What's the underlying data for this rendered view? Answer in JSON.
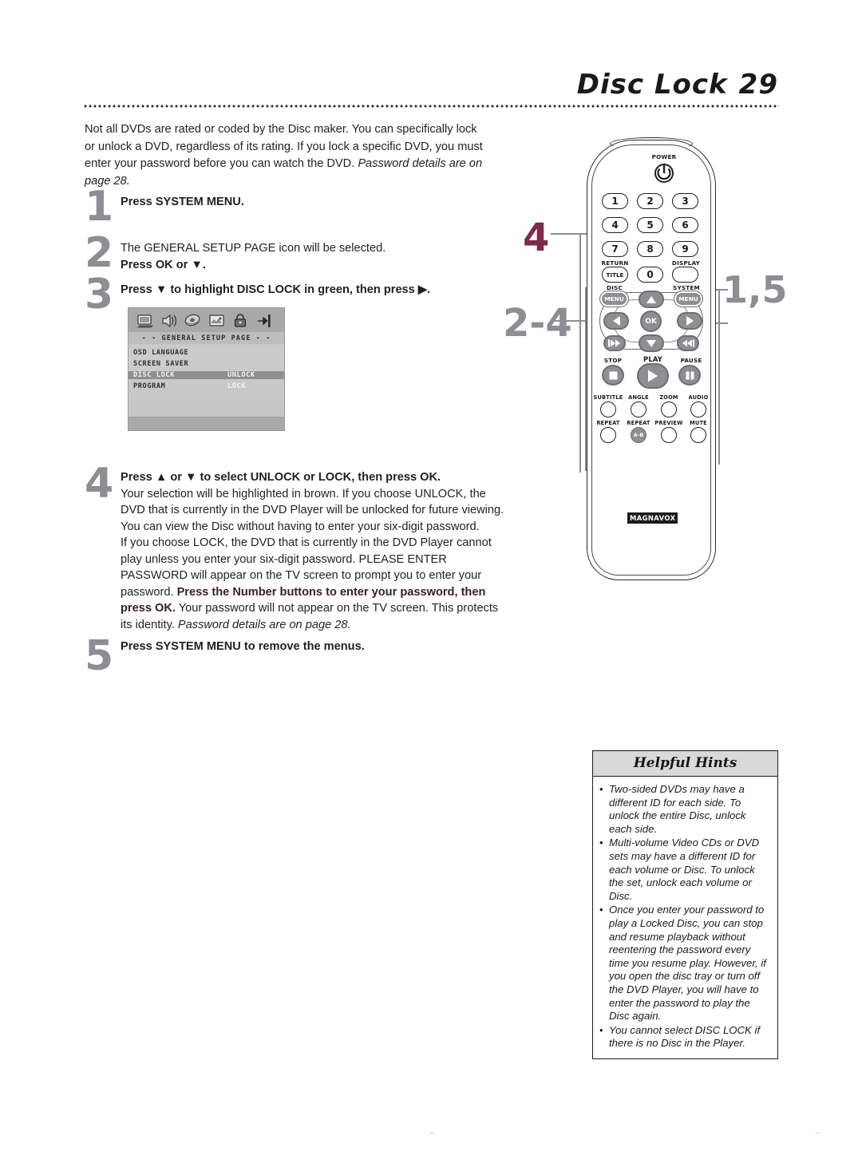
{
  "header": {
    "title": "Disc Lock",
    "page_number": "29"
  },
  "intro": {
    "text_plain": "Not all DVDs are rated or coded by the Disc maker. You can specifically lock or unlock a DVD, regardless of its rating. If you lock a specific DVD, you must enter your password before you can watch the DVD. ",
    "text_italic": "Password details are on page 28."
  },
  "steps": [
    {
      "number": "1",
      "bold_lead": "Press SYSTEM MENU.",
      "rest": ""
    },
    {
      "number": "2",
      "plain_lead": "The GENERAL SETUP PAGE icon will be selected.",
      "bold_lead": "Press OK or ▼."
    },
    {
      "number": "3",
      "bold_lead": "Press ▼  to highlight DISC LOCK in green, then press ▶."
    },
    {
      "number": "4",
      "bold_lead": "Press ▲ or ▼ to select UNLOCK or LOCK, then press OK.",
      "para1": "Your selection will be highlighted in brown. If you choose UNLOCK, the DVD that is currently in the DVD Player will be unlocked for future viewing. You can view the Disc without having to enter your six-digit password.",
      "para2_a": "If you choose LOCK, the DVD that is currently in the DVD Player cannot play unless you enter your six-digit password. PLEASE ENTER PASSWORD will appear on the TV screen to prompt you to enter your password. ",
      "para2_bold": "Press the Number buttons to enter your password, then press OK.",
      "para2_b": "  Your password will not appear on the TV screen. This protects its identity. ",
      "para2_italic": "Password details are on page 28."
    },
    {
      "number": "5",
      "bold_lead": "Press SYSTEM MENU",
      "rest": " to remove the menus."
    }
  ],
  "tv_screen": {
    "icons": [
      "monitor-icon",
      "speaker-icon",
      "disc-icon",
      "picture-icon",
      "lock-icon",
      "exit-icon"
    ],
    "heading": "- -  GENERAL  SETUP  PAGE  - -",
    "rows": [
      {
        "label": "OSD LANGUAGE",
        "value": "",
        "label_selected": false,
        "value_selected": false
      },
      {
        "label": "SCREEN SAVER",
        "value": "",
        "label_selected": false,
        "value_selected": false
      },
      {
        "label": "DISC LOCK",
        "value": "UNLOCK",
        "label_selected": true,
        "value_selected": true
      },
      {
        "label": "PROGRAM",
        "value": "LOCK",
        "label_selected": false,
        "value_selected": false
      }
    ]
  },
  "callouts": [
    {
      "id": "callout-4",
      "text": "4",
      "color": "#7e2a4a"
    },
    {
      "id": "callout-24",
      "text": "2-4",
      "color": "#8d8d93"
    },
    {
      "id": "callout-15",
      "text": "1,5",
      "color": "#8d8d93"
    }
  ],
  "remote": {
    "brand": "MAGNAVOX",
    "power_label": "POWER",
    "number_keys": [
      "1",
      "2",
      "3",
      "4",
      "5",
      "6",
      "7",
      "8",
      "9",
      "0"
    ],
    "return_label": "RETURN",
    "title_key": "TITLE",
    "display_label": "DISPLAY",
    "disc_label": "DISC",
    "system_label": "SYSTEM",
    "menu_key": "MENU",
    "ok_key": "OK",
    "stop_label": "STOP",
    "play_label": "PLAY",
    "pause_label": "PAUSE",
    "feature_row1": [
      "SUBTITLE",
      "ANGLE",
      "ZOOM",
      "AUDIO"
    ],
    "feature_row2": [
      "REPEAT",
      "REPEAT",
      "PREVIEW",
      "MUTE"
    ],
    "repeat_ab": "A-B"
  },
  "hints": {
    "title": "Helpful Hints",
    "items": [
      "Two-sided DVDs may have a different ID for each side. To unlock the entire Disc, unlock each side.",
      "Multi-volume Video CDs or DVD sets may have a different ID for each volume or Disc. To unlock the set, unlock each volume or Disc.",
      "Once you enter your password to play a Locked Disc, you can stop and resume playback without reentering the password every time you resume play. However, if you open the disc tray or turn off the DVD Player, you will have to enter the password to play the Disc again.",
      "You cannot select DISC LOCK if there is no Disc in the Player."
    ],
    "bullet": "•"
  }
}
